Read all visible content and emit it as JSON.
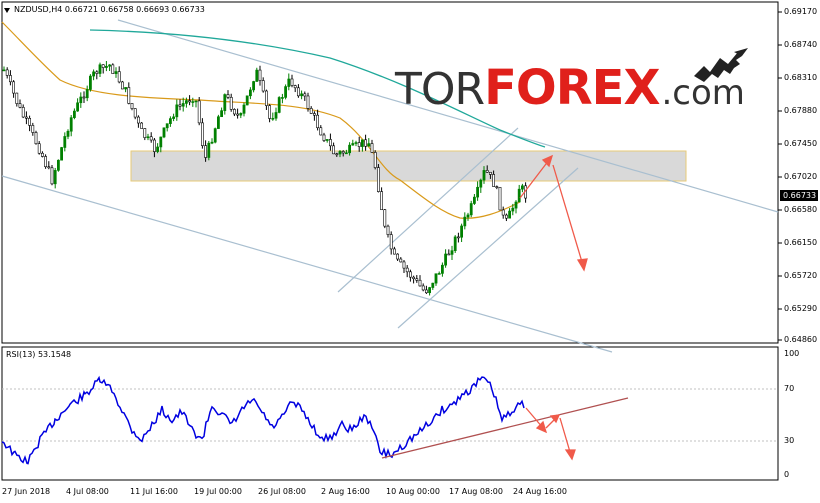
{
  "symbol_header": "NZDUSD,H4  0.66721 0.66758 0.66693 0.66733",
  "rsi_header": "RSI(13) 53.1548",
  "current_price": "0.66733",
  "price_axis": [
    "0.69170",
    "0.68740",
    "0.68310",
    "0.67880",
    "0.67450",
    "0.67020",
    "0.66580",
    "0.66150",
    "0.65720",
    "0.65290",
    "0.64860"
  ],
  "rsi_axis": [
    "100",
    "70",
    "30",
    "0"
  ],
  "time_axis": [
    "27 Jun 2018",
    "4 Jul 08:00",
    "11 Jul 16:00",
    "19 Jul 00:00",
    "26 Jul 08:00",
    "2 Aug 16:00",
    "10 Aug 00:00",
    "17 Aug 08:00",
    "24 Aug 16:00"
  ],
  "logo": {
    "tor": "TOR",
    "forex": "FOREX",
    "com": ".com"
  },
  "colors": {
    "bull": "#008000",
    "bear": "#000000",
    "ma_fast": "#d99a1a",
    "ma_slow": "#20a89a",
    "rsi": "#0000e0",
    "trend": "#a9bfd0",
    "arrow": "#f05a4a",
    "zone": "#d8d8d8"
  },
  "icons": [
    "dropdown-triangle-icon",
    "bull-logo-icon"
  ]
}
